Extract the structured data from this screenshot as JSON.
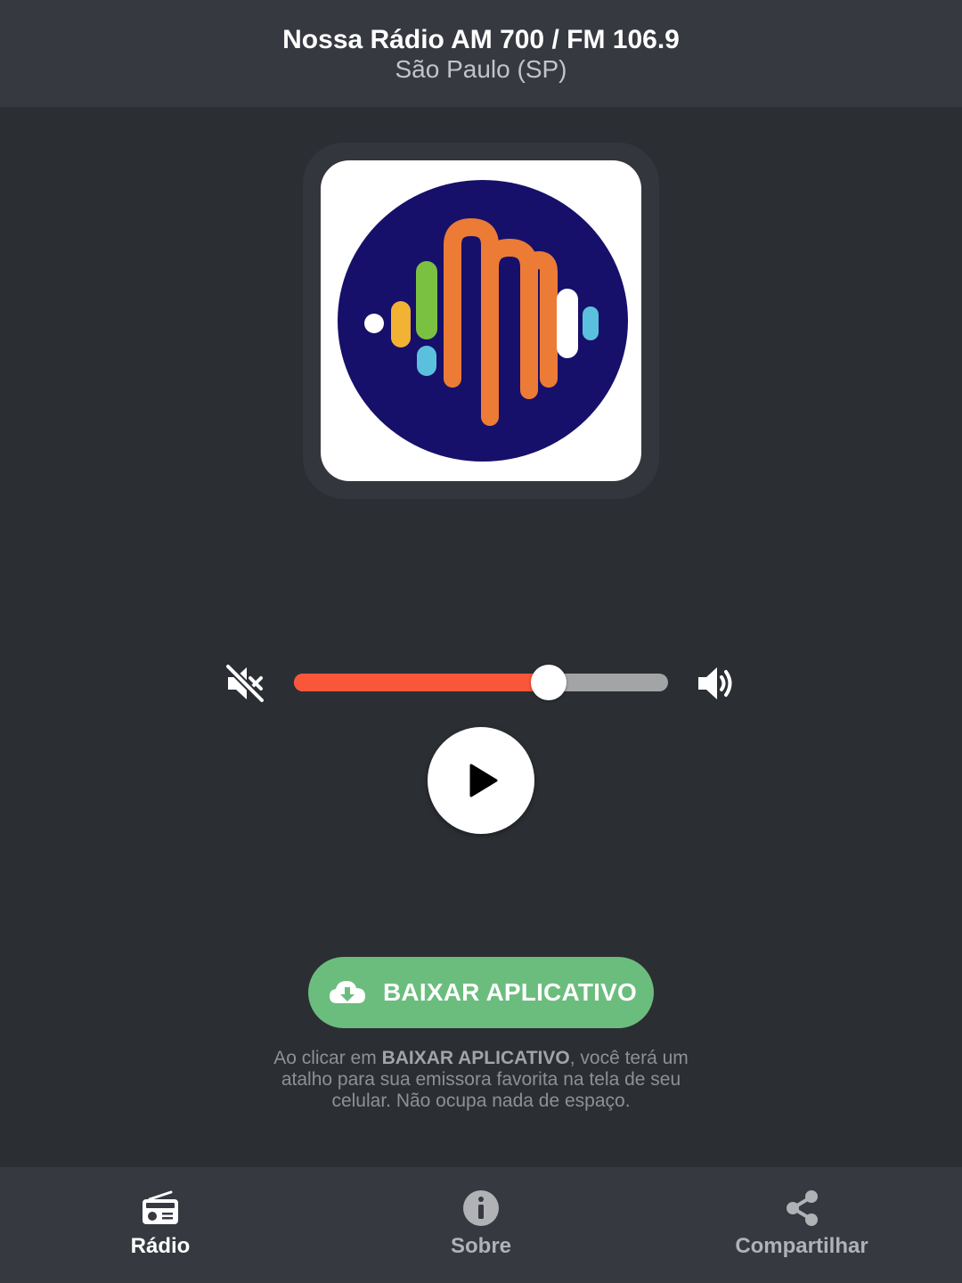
{
  "header": {
    "title": "Nossa Rádio AM 700 / FM 106.9",
    "subtitle": "São Paulo (SP)"
  },
  "logo": {
    "icon": "station-logo",
    "colors": {
      "circle": "#16106a",
      "orange": "#ec7b36",
      "green": "#7ac142",
      "yellow": "#f2b233",
      "blue": "#5bc0de",
      "white": "#ffffff"
    }
  },
  "player": {
    "volume_level": 0.68,
    "mute_icon": "volume-mute-icon",
    "volume_icon": "volume-up-icon",
    "play_icon": "play-icon",
    "accent_color": "#f9563a"
  },
  "download": {
    "button_label": "BAIXAR APLICATIVO",
    "icon": "cloud-download-icon",
    "color": "#6bbd7d",
    "note_prefix": "Ao clicar em ",
    "note_bold": "BAIXAR APLICATIVO",
    "note_suffix": ", você terá um atalho para sua emissora favorita na tela de seu celular. Não ocupa nada de espaço."
  },
  "nav": {
    "items": [
      {
        "label": "Rádio",
        "icon": "radio-icon",
        "active": true
      },
      {
        "label": "Sobre",
        "icon": "info-icon",
        "active": false
      },
      {
        "label": "Compartilhar",
        "icon": "share-icon",
        "active": false
      }
    ]
  }
}
